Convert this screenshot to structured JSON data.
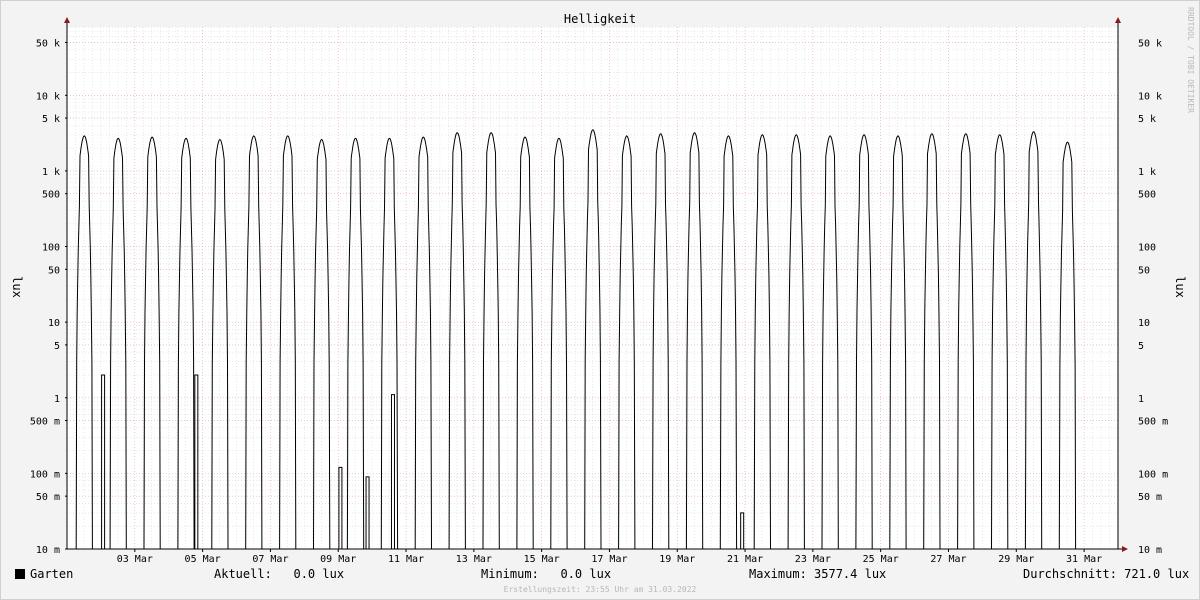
{
  "chart_data": {
    "type": "line",
    "title": "Helligkeit",
    "ylabel": "lux",
    "watermark": "RRDTOOL / TOBI OETIKER",
    "y_scale": "log",
    "ylim": [
      0.01,
      80000
    ],
    "y_ticks": [
      {
        "value": 50000,
        "label": "50 k"
      },
      {
        "value": 10000,
        "label": "10 k"
      },
      {
        "value": 5000,
        "label": "5 k"
      },
      {
        "value": 1000,
        "label": "1 k"
      },
      {
        "value": 500,
        "label": "500"
      },
      {
        "value": 100,
        "label": "100"
      },
      {
        "value": 50,
        "label": "50"
      },
      {
        "value": 10,
        "label": "10"
      },
      {
        "value": 5,
        "label": "5"
      },
      {
        "value": 1,
        "label": "1"
      },
      {
        "value": 0.5,
        "label": "500 m"
      },
      {
        "value": 0.1,
        "label": "100 m"
      },
      {
        "value": 0.05,
        "label": "50 m"
      },
      {
        "value": 0.01,
        "label": "10 m"
      }
    ],
    "x_ticks": [
      {
        "day": 3,
        "label": "03 Mar"
      },
      {
        "day": 5,
        "label": "05 Mar"
      },
      {
        "day": 7,
        "label": "07 Mar"
      },
      {
        "day": 9,
        "label": "09 Mar"
      },
      {
        "day": 11,
        "label": "11 Mar"
      },
      {
        "day": 13,
        "label": "13 Mar"
      },
      {
        "day": 15,
        "label": "15 Mar"
      },
      {
        "day": 17,
        "label": "17 Mar"
      },
      {
        "day": 19,
        "label": "19 Mar"
      },
      {
        "day": 21,
        "label": "21 Mar"
      },
      {
        "day": 23,
        "label": "23 Mar"
      },
      {
        "day": 25,
        "label": "25 Mar"
      },
      {
        "day": 27,
        "label": "27 Mar"
      },
      {
        "day": 29,
        "label": "29 Mar"
      },
      {
        "day": 31,
        "label": "31 Mar"
      }
    ],
    "x_range_days": [
      1,
      32
    ],
    "series": [
      {
        "name": "Garten",
        "color": "#000000",
        "daily_peak_lux": [
          2900,
          2700,
          2800,
          2700,
          2600,
          2900,
          2900,
          2600,
          2700,
          2700,
          2800,
          3200,
          3200,
          2800,
          2700,
          3500,
          2900,
          3100,
          3200,
          2900,
          3000,
          3000,
          2900,
          3000,
          2900,
          3100,
          3100,
          3000,
          3300,
          2400
        ],
        "night_spikes": [
          {
            "day": 2.05,
            "lux": 2
          },
          {
            "day": 4.8,
            "lux": 2
          },
          {
            "day": 9.05,
            "lux": 0.12
          },
          {
            "day": 9.85,
            "lux": 0.09
          },
          {
            "day": 10.6,
            "lux": 1.1
          },
          {
            "day": 20.9,
            "lux": 0.03
          }
        ]
      }
    ],
    "grid": true
  },
  "legend": {
    "series_name": "Garten",
    "aktuell_label": "Aktuell:",
    "aktuell_value": "0.0 lux",
    "minimum_label": "Minimum:",
    "minimum_value": "0.0 lux",
    "maximum_label": "Maximum:",
    "maximum_value": "3577.4 lux",
    "durchschnitt_label": "Durchschnitt:",
    "durchschnitt_value": "721.0 lux"
  },
  "footer": "Erstellungszeit: 23:55 Uhr am 31.03.2022"
}
